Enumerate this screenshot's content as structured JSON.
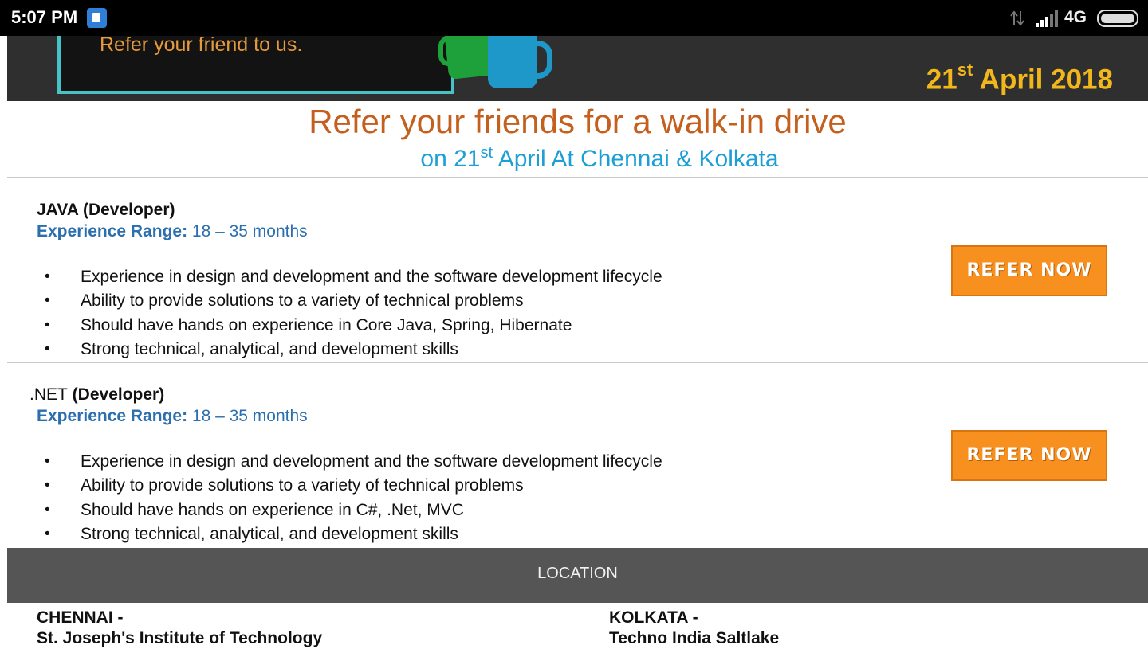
{
  "status_bar": {
    "time": "5:07 PM",
    "network": "4G"
  },
  "banner": {
    "tagline": "Refer your friend to us.",
    "date_day": "21",
    "date_suffix": "st",
    "date_rest": " April 2018"
  },
  "headline": "Refer your friends for a walk-in drive",
  "subline": {
    "prefix": "on 21",
    "suffix": "st",
    "rest": " April At Chennai & Kolkata"
  },
  "jobs": [
    {
      "title": "JAVA (Developer)",
      "exp_label": "Experience Range:",
      "exp_value": " 18 – 35 months",
      "bullets": [
        "Experience in design and development and the software development lifecycle",
        "Ability to provide solutions to a variety of technical problems",
        "Should have hands on experience in Core Java, Spring, Hibernate",
        "Strong technical, analytical, and development skills"
      ],
      "button": "REFER NOW"
    },
    {
      "title_plain": ".NET",
      "title_bold": " (Developer)",
      "exp_label": "Experience Range:",
      "exp_value": " 18 – 35 months",
      "bullets": [
        "Experience in design and development and the software development lifecycle",
        "Ability to provide solutions to a variety of technical problems",
        "Should have hands on experience in C#, .Net,  MVC",
        "Strong technical, analytical, and development skills"
      ],
      "button": "REFER NOW"
    }
  ],
  "location": {
    "header": "LOCATION",
    "chennai_label": "CHENNAI -",
    "chennai_venue": "St. Joseph's Institute of Technology",
    "kolkata_label": "KOLKATA -",
    "kolkata_venue": "Techno India Saltlake"
  }
}
